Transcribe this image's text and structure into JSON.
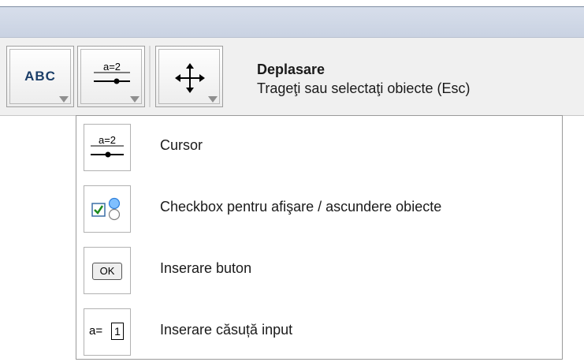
{
  "toolbar": {
    "text_tool_label": "ABC",
    "slider_tool_label": "a=2",
    "move_tool_icon": "move-arrows-icon",
    "help_title": "Deplasare",
    "help_description": "Trageţi sau selectaţi obiecte (Esc)"
  },
  "menu": {
    "items": [
      {
        "icon": "slider-icon",
        "icon_text": "a=2",
        "label": "Cursor"
      },
      {
        "icon": "checkbox-icon",
        "label": "Checkbox pentru afişare / ascundere obiecte"
      },
      {
        "icon": "button-icon",
        "icon_text": "OK",
        "label": "Inserare buton"
      },
      {
        "icon": "input-box-icon",
        "icon_text": "a=",
        "icon_value": "1",
        "label": "Inserare căsuță input"
      }
    ]
  },
  "colors": {
    "titlebar": "#d0d8e6",
    "toolbar_bg": "#f0f0f0",
    "abc_text": "#1b3e68",
    "checkbox_check": "#1e8a1e",
    "ball_blue": "#2f7fd9"
  }
}
